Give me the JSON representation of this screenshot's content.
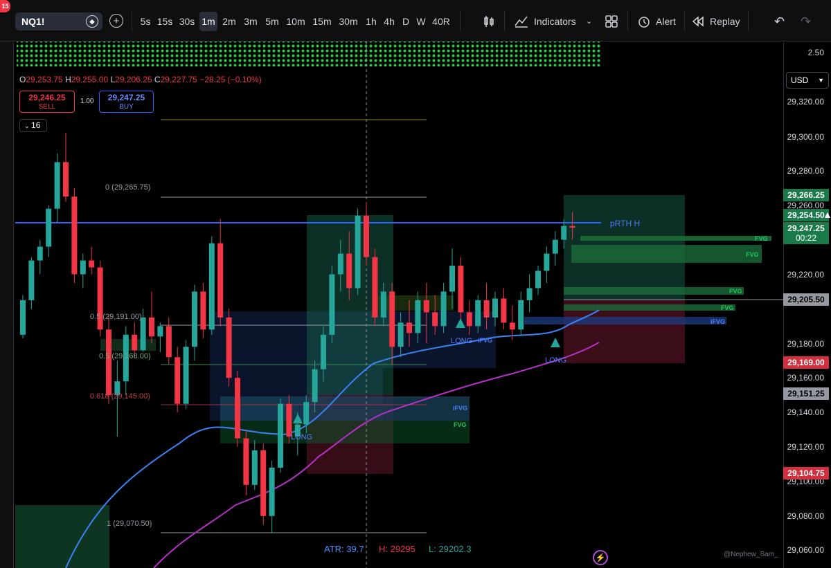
{
  "toolbar": {
    "notification_count": "15",
    "symbol": "NQ1!",
    "intervals": [
      "5s",
      "15s",
      "30s",
      "1m",
      "2m",
      "3m",
      "5m",
      "10m",
      "15m",
      "30m",
      "1h",
      "4h",
      "D",
      "W",
      "40R"
    ],
    "active_interval": "1m",
    "indicators_label": "Indicators",
    "alert_label": "Alert",
    "replay_label": "Replay"
  },
  "legend": {
    "open": "29,253.75",
    "high": "29,255.00",
    "low": "29,206.25",
    "close": "29,227.75",
    "change": "−28.25 (−0.10%)",
    "sell_price": "29,246.25",
    "sell_label": "SELL",
    "qty": "1.00",
    "buy_price": "29,247.25",
    "buy_label": "BUY",
    "indicator_count": "16"
  },
  "price_axis": {
    "currency": "USD",
    "ticks": [
      "2.50",
      "29,320.00",
      "29,300.00",
      "29,280.00",
      "29,260.00",
      "29,240.00",
      "29,220.00",
      "29,200.00",
      "29,180.00",
      "29,160.00",
      "29,140.00",
      "29,120.00",
      "29,100.00",
      "29,080.00",
      "29,060.00"
    ],
    "labels": {
      "target": "29,266.25",
      "prev_high": "29,254.50",
      "last_price": "29,247.25",
      "countdown": "00:22",
      "level_a": "29,205.50",
      "stop": "29,169.00",
      "level_b": "29,151.25",
      "stop_low": "29,104.75"
    }
  },
  "fib_levels": {
    "top": "0 (29,265.75)",
    "mid1": "0.5 (29,191.00)",
    "mid2": "0.5 (29,168.00)",
    "mid3": "0.618 (29,145.00)",
    "bottom": "1 (29,070.50)"
  },
  "annotations": {
    "prth": "pRTH H",
    "fvg": "FVG",
    "ifvg": "iFVG",
    "long": "LONG"
  },
  "stats": {
    "atr": "ATR: 39.7",
    "high": "H: 29295",
    "low": "L: 29202.3"
  },
  "watermark": "@Nephew_Sam_",
  "colors": {
    "bull": "#26a69a",
    "bear": "#f23645",
    "accent_blue": "#2962ff",
    "fvg_green": "#22c55e",
    "ema_fast": "#3b82f6",
    "ema_slow": "#b730c9"
  },
  "chart_data": {
    "type": "candlestick",
    "symbol": "NQ1!",
    "interval": "1m",
    "ylim": [
      29060,
      29325
    ],
    "candles_ohlc": [
      [
        29185,
        29208,
        29183,
        29205
      ],
      [
        29205,
        29230,
        29200,
        29228
      ],
      [
        29228,
        29240,
        29220,
        29236
      ],
      [
        29236,
        29260,
        29230,
        29258
      ],
      [
        29258,
        29290,
        29250,
        29285
      ],
      [
        29285,
        29302,
        29262,
        29265
      ],
      [
        29265,
        29270,
        29215,
        29220
      ],
      [
        29220,
        29232,
        29212,
        29228
      ],
      [
        29228,
        29236,
        29220,
        29224
      ],
      [
        29224,
        29228,
        29184,
        29188
      ],
      [
        29188,
        29196,
        29145,
        29150
      ],
      [
        29150,
        29170,
        29126,
        29158
      ],
      [
        29158,
        29190,
        29150,
        29185
      ],
      [
        29185,
        29192,
        29172,
        29176
      ],
      [
        29176,
        29200,
        29175,
        29195
      ],
      [
        29195,
        29210,
        29180,
        29184
      ],
      [
        29184,
        29192,
        29175,
        29190
      ],
      [
        29190,
        29195,
        29168,
        29172
      ],
      [
        29172,
        29178,
        29140,
        29145
      ],
      [
        29145,
        29182,
        29142,
        29178
      ],
      [
        29178,
        29214,
        29170,
        29210
      ],
      [
        29210,
        29215,
        29183,
        29188
      ],
      [
        29188,
        29242,
        29185,
        29238
      ],
      [
        29238,
        29252,
        29190,
        29195
      ],
      [
        29195,
        29200,
        29155,
        29160
      ],
      [
        29160,
        29164,
        29120,
        29125
      ],
      [
        29125,
        29130,
        29092,
        29098
      ],
      [
        29098,
        29124,
        29095,
        29118
      ],
      [
        29118,
        29122,
        29075,
        29080
      ],
      [
        29080,
        29112,
        29070,
        29108
      ],
      [
        29108,
        29148,
        29105,
        29145
      ],
      [
        29145,
        29150,
        29122,
        29126
      ],
      [
        29126,
        29140,
        29115,
        29133
      ],
      [
        29133,
        29150,
        29128,
        29146
      ],
      [
        29146,
        29170,
        29140,
        29165
      ],
      [
        29165,
        29190,
        29158,
        29185
      ],
      [
        29185,
        29225,
        29180,
        29220
      ],
      [
        29220,
        29240,
        29210,
        29232
      ],
      [
        29232,
        29245,
        29205,
        29212
      ],
      [
        29212,
        29258,
        29208,
        29254
      ],
      [
        29254,
        29262,
        29225,
        29230
      ],
      [
        29230,
        29235,
        29190,
        29195
      ],
      [
        29195,
        29215,
        29190,
        29210
      ],
      [
        29210,
        29215,
        29168,
        29178
      ],
      [
        29178,
        29198,
        29172,
        29192
      ],
      [
        29192,
        29205,
        29178,
        29186
      ],
      [
        29186,
        29210,
        29180,
        29205
      ],
      [
        29205,
        29215,
        29180,
        29198
      ],
      [
        29198,
        29208,
        29185,
        29190
      ],
      [
        29190,
        29215,
        29186,
        29210
      ],
      [
        29210,
        29235,
        29200,
        29225
      ],
      [
        29225,
        29230,
        29190,
        29198
      ],
      [
        29198,
        29205,
        29185,
        29190
      ],
      [
        29190,
        29208,
        29186,
        29205
      ],
      [
        29205,
        29215,
        29188,
        29195
      ],
      [
        29195,
        29210,
        29190,
        29206
      ],
      [
        29206,
        29212,
        29188,
        29192
      ],
      [
        29192,
        29202,
        29182,
        29188
      ],
      [
        29188,
        29210,
        29185,
        29205
      ],
      [
        29205,
        29220,
        29198,
        29212
      ],
      [
        29212,
        29225,
        29208,
        29222
      ],
      [
        29222,
        29236,
        29215,
        29232
      ],
      [
        29232,
        29245,
        29225,
        29240
      ],
      [
        29240,
        29252,
        29235,
        29248
      ],
      [
        29248,
        29256,
        29240,
        29247
      ]
    ],
    "series": [
      {
        "name": "EMA fast"
      },
      {
        "name": "EMA slow"
      }
    ]
  }
}
